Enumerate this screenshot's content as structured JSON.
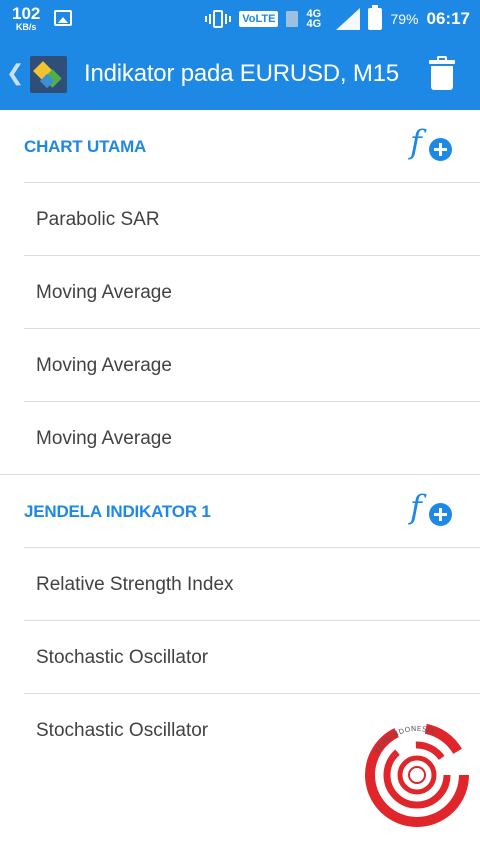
{
  "status_bar": {
    "speed_value": "102",
    "speed_unit": "KB/s",
    "volte": "VoLTE",
    "network": "4G",
    "network2": "4G",
    "battery": "79%",
    "time": "06:17"
  },
  "appbar": {
    "title": "Indikator pada EURUSD, M15"
  },
  "sections": [
    {
      "title": "CHART UTAMA",
      "items": [
        "Parabolic SAR",
        "Moving Average",
        "Moving Average",
        "Moving Average"
      ]
    },
    {
      "title": "JENDELA INDIKATOR 1",
      "items": [
        "Relative Strength Index",
        "Stochastic Oscillator",
        "Stochastic Oscillator"
      ]
    }
  ],
  "watermark": {
    "text": "KEPOINDONESIA"
  },
  "colors": {
    "accent": "#1e88e5",
    "text": "#424242",
    "divider": "#dcdcdc",
    "watermark": "#e0262b"
  },
  "icons": {
    "back": "chevron-left-icon",
    "app": "metatrader-logo-icon",
    "delete": "trash-icon",
    "add_indicator": "function-add-icon"
  }
}
